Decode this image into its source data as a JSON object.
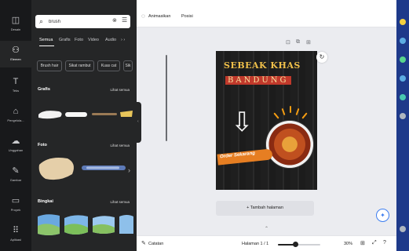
{
  "rail": [
    {
      "label": "Desain",
      "icon": "layout-icon",
      "glyph": "◫",
      "active": false
    },
    {
      "label": "Elemen",
      "icon": "elements-icon",
      "glyph": "⚇",
      "active": true
    },
    {
      "label": "Teks",
      "icon": "text-icon",
      "glyph": "T",
      "active": false
    },
    {
      "label": "Pengelola...",
      "icon": "brand-icon",
      "glyph": "⌂",
      "active": false
    },
    {
      "label": "Unggahan",
      "icon": "upload-icon",
      "glyph": "☁",
      "active": false
    },
    {
      "label": "Gambar",
      "icon": "draw-icon",
      "glyph": "✎",
      "active": false
    },
    {
      "label": "Proyek",
      "icon": "folder-icon",
      "glyph": "▭",
      "active": false
    },
    {
      "label": "Aplikasi",
      "icon": "apps-icon",
      "glyph": "⠿",
      "active": false
    }
  ],
  "panel": {
    "search_value": "brush",
    "tabs": [
      "Semua",
      "Grafis",
      "Foto",
      "Video",
      "Audio"
    ],
    "chips": [
      "Brush hair",
      "Sikat rambut",
      "Kuas cat",
      "Sik"
    ],
    "sections": [
      {
        "title": "Grafis",
        "see_all": "Lihat semua"
      },
      {
        "title": "Foto",
        "see_all": "Lihat semua"
      },
      {
        "title": "Bingkai",
        "see_all": "Lihat semua"
      }
    ]
  },
  "toolbar": {
    "animate": "Animasikan",
    "position": "Posisi"
  },
  "design": {
    "headline1": "SEBEAK KHAS",
    "headline2": "BANDUNG",
    "ribbon": "Order Sekarang"
  },
  "canvas": {
    "add_page": "+ Tambah halaman"
  },
  "bottom": {
    "notes": "Catatan",
    "page": "Halaman 1 / 1",
    "zoom": "30%",
    "zoom_level": 0.3
  },
  "colors": {
    "sidebar": "#18191b",
    "panel": "#252627",
    "accent": "#3d7ef0",
    "headline": "#f0c04a",
    "ribbon": "#e67e22"
  }
}
